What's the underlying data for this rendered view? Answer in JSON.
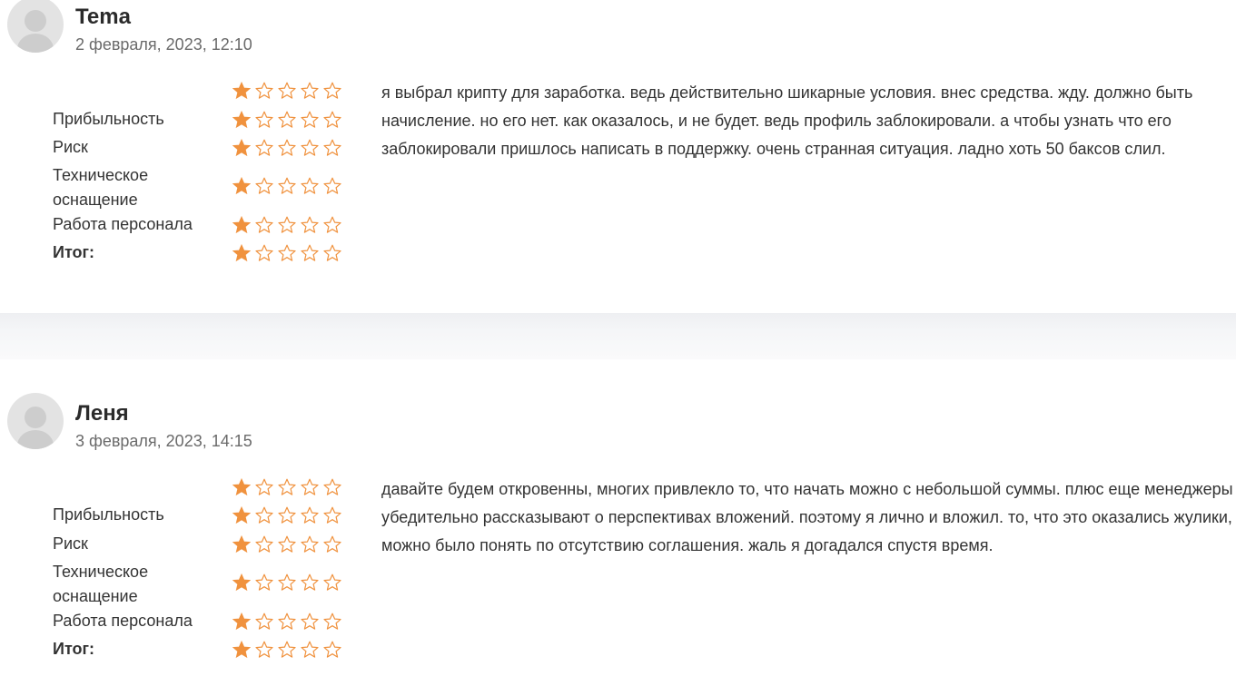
{
  "star_color": "#f0923e",
  "reviews": [
    {
      "author": "Tema",
      "date": "2 февраля, 2023, 12:10",
      "text": "я выбрал крипту для заработка. ведь действительно шикарные условия. внес средства. жду. должно быть начисление. но его нет. как оказалось, и не будет. ведь профиль заблокировали. а чтобы узнать что его заблокировали пришлось написать в поддержку. очень странная ситуация. ладно хоть 50 баксов слил.",
      "overall_rating": 1,
      "criteria": [
        {
          "label": "Прибыльность",
          "rating": 1
        },
        {
          "label": "Риск",
          "rating": 1
        },
        {
          "label": "Техническое оснащение",
          "rating": 1
        },
        {
          "label": "Работа персонала",
          "rating": 1
        },
        {
          "label": "Итог:",
          "rating": 1
        }
      ]
    },
    {
      "author": "Леня",
      "date": "3 февраля, 2023, 14:15",
      "text": "давайте будем откровенны, многих привлекло то, что начать можно с небольшой суммы. плюс еще менеджеры убедительно рассказывают о перспективах вложений. поэтому я лично и вложил. то, что это оказались жулики, можно было понять по отсутствию соглашения. жаль я догадался спустя время.",
      "overall_rating": 1,
      "criteria": [
        {
          "label": "Прибыльность",
          "rating": 1
        },
        {
          "label": "Риск",
          "rating": 1
        },
        {
          "label": "Техническое оснащение",
          "rating": 1
        },
        {
          "label": "Работа персонала",
          "rating": 1
        },
        {
          "label": "Итог:",
          "rating": 1
        }
      ]
    }
  ]
}
